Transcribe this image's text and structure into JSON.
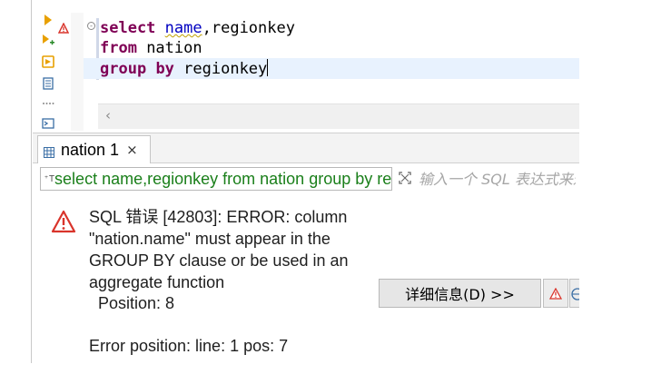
{
  "editor": {
    "lines": [
      [
        {
          "t": "select",
          "k": "kw"
        },
        {
          "t": " "
        },
        {
          "t": "name",
          "k": "squiggle"
        },
        {
          "t": ",regionkey"
        }
      ],
      [
        {
          "t": "from",
          "k": "kw"
        },
        {
          "t": " nation"
        }
      ],
      [
        {
          "t": "group",
          "k": "kw"
        },
        {
          "t": " "
        },
        {
          "t": "by",
          "k": "kw"
        },
        {
          "t": " regionkey"
        }
      ]
    ],
    "hscroll_left": "‹"
  },
  "results": {
    "tab_label": "nation 1",
    "tab_close": "×",
    "query_icon": "⁺T",
    "query_text": "select name,regionkey from nation group by regionkey",
    "filter_placeholder": "输入一个 SQL 表达式来过滤结果"
  },
  "error": {
    "lines": [
      "SQL 错误 [42803]: ERROR: column",
      "\"nation.name\" must appear in the",
      "GROUP BY clause or be used in an",
      "aggregate function",
      "  Position: 8",
      "",
      "Error position: line: 1 pos: 7"
    ],
    "details_button": "详细信息(D) >>"
  },
  "colors": {
    "keyword": "#7f0055",
    "query_text": "#1a7f1a",
    "error_icon": "#d9342b",
    "tool_orange": "#e8a000"
  },
  "icons": {
    "tools": [
      "execute-statement-icon",
      "execute-script-icon",
      "export-icon",
      "explain-plan-icon",
      "more-icon",
      "console-icon"
    ],
    "warning_marker": "warning-triangle-icon",
    "tab_icon": "grid-table-icon",
    "filter_icon": "expand-filter-icon",
    "error_icon": "error-triangle-icon"
  }
}
